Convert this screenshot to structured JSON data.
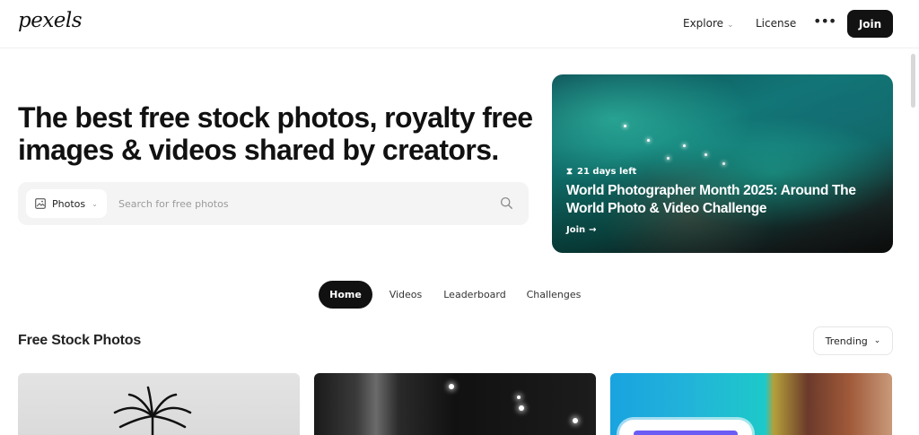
{
  "nav": {
    "logo": "pexels",
    "explore": "Explore",
    "license": "License",
    "more": "•••",
    "join": "Join"
  },
  "hero": {
    "title": "The best free stock photos, royalty free images & videos shared by creators.",
    "search": {
      "type_label": "Photos",
      "placeholder": "Search for free photos"
    }
  },
  "feature": {
    "days_left": "21 days left",
    "title": "World Photographer Month 2025: Around The World Photo & Video Challenge",
    "link": "Join"
  },
  "tabs": [
    "Home",
    "Videos",
    "Leaderboard",
    "Challenges"
  ],
  "section": {
    "title": "Free Stock Photos",
    "sort": "Trending"
  },
  "icons": {
    "search": "search-icon",
    "image": "image-icon",
    "hourglass": "hourglass-icon",
    "arrow": "arrow-right-icon",
    "chevron": "chevron-down-icon"
  },
  "colors": {
    "primary": "#121212",
    "search_bg": "#f4f4f4",
    "placeholder": "#9a9a9a"
  }
}
